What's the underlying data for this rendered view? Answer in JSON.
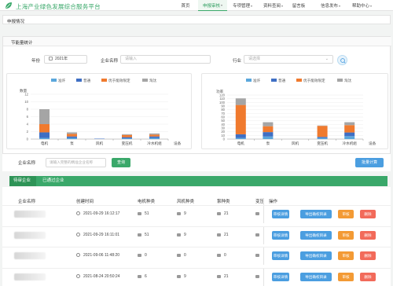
{
  "app": {
    "title": "上海产业绿色发展综合服务平台"
  },
  "nav": [
    {
      "label": "首页",
      "caret": false,
      "active": false
    },
    {
      "label": "申报审核",
      "caret": true,
      "active": true
    },
    {
      "label": "专项管理",
      "caret": true,
      "active": false
    },
    {
      "label": "资料查阅",
      "caret": true,
      "active": false
    },
    {
      "label": "留言板",
      "caret": false,
      "active": false
    },
    {
      "label": "信息发布",
      "caret": true,
      "active": false
    },
    {
      "label": "帮助中心",
      "caret": true,
      "active": false
    }
  ],
  "breadcrumb": "申报情况",
  "panel": {
    "title": "节能量统计"
  },
  "filters": {
    "year_label": "年份",
    "year_value": "2021年",
    "company_label": "企业名称",
    "company_placeholder": "请输入",
    "industry_label": "行业",
    "industry_placeholder": "请选择"
  },
  "legend": [
    "准许",
    "普通",
    "优于能效限定",
    "淘汰"
  ],
  "colors": {
    "series": [
      "#5ba7dc",
      "#3f6fc4",
      "#f07a2e",
      "#a5a5a5"
    ],
    "brand": "#3aa86a",
    "blue_button": "#4b9ee0"
  },
  "chart_data": [
    {
      "type": "bar",
      "stacked": true,
      "ylabel": "数量",
      "xlabel": "设备",
      "categories": [
        "电机",
        "泵",
        "风机",
        "变压机",
        "冷水机组"
      ],
      "yticks": [
        "0",
        "2",
        "4",
        "6",
        "8",
        "10",
        "12"
      ],
      "ylim": [
        0,
        12
      ],
      "series": [
        {
          "name": "准许",
          "values": [
            0.3,
            0.3,
            0,
            0.2,
            0.3
          ]
        },
        {
          "name": "普通",
          "values": [
            1.5,
            0.4,
            0.1,
            0.3,
            0.4
          ]
        },
        {
          "name": "优于能效限定",
          "values": [
            2.2,
            0.7,
            0,
            0.6,
            0.5
          ]
        },
        {
          "name": "淘汰",
          "values": [
            4.0,
            0.4,
            0,
            0.2,
            0.3
          ]
        }
      ]
    },
    {
      "type": "bar",
      "stacked": true,
      "ylabel": "功率",
      "xlabel": "设备",
      "categories": [
        "电机",
        "泵",
        "风机",
        "变压机",
        "冷水机组"
      ],
      "yticks": [
        "0",
        "10",
        "20",
        "30",
        "40",
        "50",
        "60",
        "70",
        "80",
        "90",
        "100",
        "110",
        "120"
      ],
      "ylim": [
        0,
        120
      ],
      "series": [
        {
          "name": "准许",
          "values": [
            3,
            7,
            0,
            3,
            8
          ]
        },
        {
          "name": "普通",
          "values": [
            10,
            12,
            0,
            3,
            10
          ]
        },
        {
          "name": "优于能效限定",
          "values": [
            80,
            16,
            0,
            30,
            20
          ]
        },
        {
          "name": "淘汰",
          "values": [
            18,
            11,
            0,
            1,
            8
          ]
        }
      ]
    }
  ],
  "company_row": {
    "label": "企业名称",
    "placeholder": "请输入完整的精准企业名称",
    "query_button": "查询",
    "batch_button": "批量计算"
  },
  "tabs": [
    "待审企业",
    "已通过企业"
  ],
  "table": {
    "headers": [
      "企业名称",
      "创建时间",
      "电机种类",
      "风机种类",
      "泵种类",
      "变压",
      "操作"
    ],
    "rows": [
      {
        "time": "2021-09-29 16:12:17",
        "motor": "51",
        "fan": "9",
        "pump": "21"
      },
      {
        "time": "2021-09-29 16:11:01",
        "motor": "51",
        "fan": "9",
        "pump": "21"
      },
      {
        "time": "2021-09-06 11:48:20",
        "motor": "0",
        "fan": "0",
        "pump": "0"
      },
      {
        "time": "2021-08-24 20:50:24",
        "motor": "6",
        "fan": "9",
        "pump": "21"
      }
    ],
    "actions": [
      "审核详情",
      "导出确权目录",
      "审核",
      "删除"
    ]
  }
}
